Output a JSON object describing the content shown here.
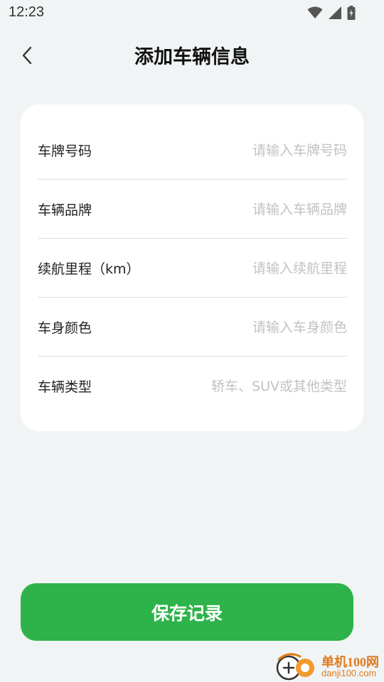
{
  "status_bar": {
    "time": "12:23",
    "icons": [
      "wifi-icon",
      "signal-icon",
      "battery-charging-icon"
    ]
  },
  "header": {
    "back_icon": "chevron-left-icon",
    "title": "添加车辆信息"
  },
  "form": {
    "fields": [
      {
        "label": "车牌号码",
        "value": "",
        "placeholder": "请输入车牌号码"
      },
      {
        "label": "车辆品牌",
        "value": "",
        "placeholder": "请输入车辆品牌"
      },
      {
        "label": "续航里程（km）",
        "value": "",
        "placeholder": "请输入续航里程"
      },
      {
        "label": "车身颜色",
        "value": "",
        "placeholder": "请输入车身颜色"
      },
      {
        "label": "车辆类型",
        "value": "",
        "placeholder": "轿车、SUV或其他类型"
      }
    ]
  },
  "save_button": {
    "label": "保存记录"
  },
  "watermark": {
    "brand": "单机100网",
    "url": "danji100.com"
  },
  "colors": {
    "background": "#f1f4f5",
    "card": "#ffffff",
    "accent": "#2db34a",
    "placeholder": "#c2c2c2",
    "watermark": "#e07a1b"
  }
}
